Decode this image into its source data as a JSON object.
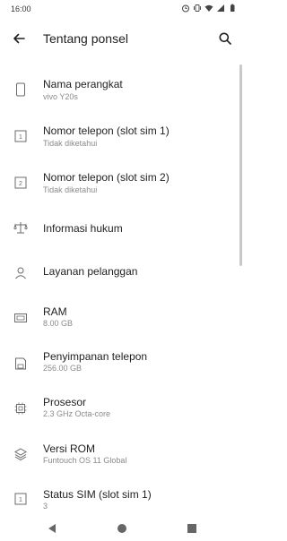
{
  "status_bar": {
    "time": "16:00",
    "icons": [
      "alarm-icon",
      "vibrate-icon",
      "wifi-icon",
      "signal-icon",
      "battery-icon"
    ]
  },
  "app_bar": {
    "title": "Tentang ponsel",
    "back_icon": "back-arrow-icon",
    "search_icon": "search-icon"
  },
  "items": [
    {
      "label": "Nama perangkat",
      "sub": "vivo Y20s",
      "icon": "phone-icon"
    },
    {
      "label": "Nomor telepon (slot sim 1)",
      "sub": "Tidak diketahui",
      "icon": "sim1-icon"
    },
    {
      "label": "Nomor telepon (slot sim 2)",
      "sub": "Tidak diketahui",
      "icon": "sim2-icon"
    },
    {
      "label": "Informasi hukum",
      "sub": "",
      "icon": "scale-icon"
    },
    {
      "label": "Layanan pelanggan",
      "sub": "",
      "icon": "person-icon"
    },
    {
      "label": "RAM",
      "sub": "8.00 GB",
      "icon": "ram-icon"
    },
    {
      "label": "Penyimpanan telepon",
      "sub": "256.00 GB",
      "icon": "storage-icon"
    },
    {
      "label": "Prosesor",
      "sub": "2.3 GHz Octa-core",
      "icon": "processor-icon"
    },
    {
      "label": "Versi ROM",
      "sub": "Funtouch OS 11 Global",
      "icon": "layers-icon"
    },
    {
      "label": "Status SIM (slot sim 1)",
      "sub": "3",
      "icon": "sim-status-icon"
    }
  ],
  "nav_bar": {
    "back": "nav-back-icon",
    "home": "nav-home-icon",
    "recents": "nav-recents-icon"
  },
  "colors": {
    "text_primary": "#1f1f1f",
    "text_secondary": "#8a8a8a",
    "icon": "#6b6b6b"
  }
}
